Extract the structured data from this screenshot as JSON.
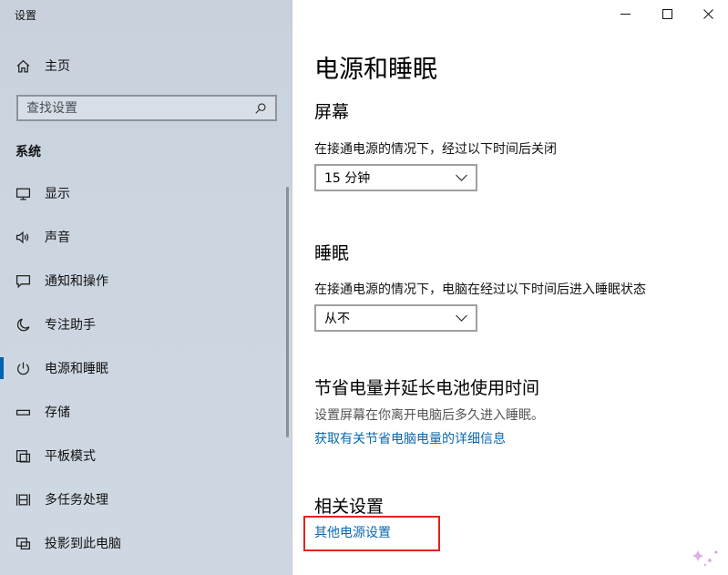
{
  "window": {
    "title": "设置",
    "controls": {
      "minimize": "minimize",
      "maximize": "maximize",
      "close": "close"
    }
  },
  "sidebar": {
    "home_label": "主页",
    "search_placeholder": "查找设置",
    "section_title": "系统",
    "items": [
      {
        "label": "显示",
        "icon": "monitor-icon"
      },
      {
        "label": "声音",
        "icon": "speaker-icon"
      },
      {
        "label": "通知和操作",
        "icon": "notification-icon"
      },
      {
        "label": "专注助手",
        "icon": "moon-icon"
      },
      {
        "label": "电源和睡眠",
        "icon": "power-icon",
        "active": true
      },
      {
        "label": "存储",
        "icon": "storage-icon"
      },
      {
        "label": "平板模式",
        "icon": "tablet-icon"
      },
      {
        "label": "多任务处理",
        "icon": "multitask-icon"
      },
      {
        "label": "投影到此电脑",
        "icon": "project-icon"
      }
    ]
  },
  "main": {
    "title": "电源和睡眠",
    "screen": {
      "heading": "屏幕",
      "description": "在接通电源的情况下，经过以下时间后关闭",
      "selected": "15 分钟"
    },
    "sleep": {
      "heading": "睡眠",
      "description": "在接通电源的情况下，电脑在经过以下时间后进入睡眠状态",
      "selected": "从不"
    },
    "battery": {
      "heading": "节省电量并延长电池使用时间",
      "description": "设置屏幕在你离开电脑后多久进入睡眠。",
      "link": "获取有关节省电脑电量的详细信息"
    },
    "related": {
      "heading": "相关设置",
      "link": "其他电源设置"
    }
  },
  "colors": {
    "accent": "#0063b1",
    "link": "#0a68b0",
    "highlight": "#e32222"
  }
}
